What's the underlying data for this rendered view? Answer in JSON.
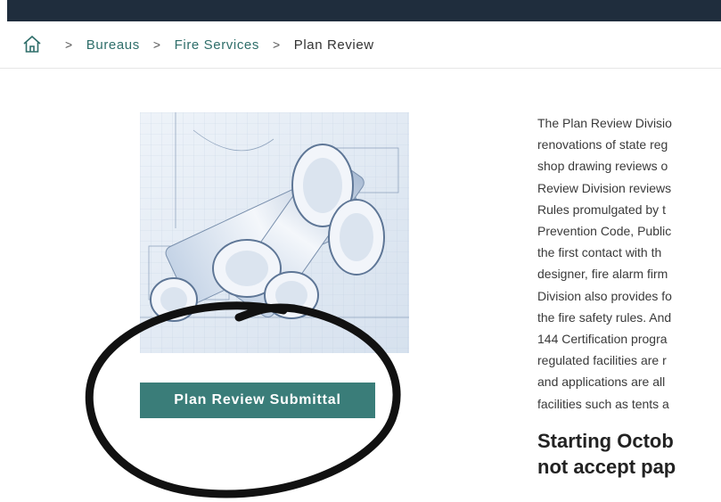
{
  "breadcrumb": {
    "items": [
      "Bureaus",
      "Fire Services"
    ],
    "current": "Plan Review",
    "separator": ">"
  },
  "hero": {
    "icon": "blueprint-rolls-image"
  },
  "cta": {
    "label": "Plan Review Submittal"
  },
  "annotation": {
    "type": "hand-drawn-circle",
    "color": "#111111"
  },
  "description": {
    "lines": [
      "The Plan Review Divisio",
      "renovations of state reg",
      "shop drawing reviews o",
      "Review Division reviews",
      "Rules promulgated by t",
      "Prevention Code, Public",
      "the first contact with th",
      "designer, fire alarm firm",
      "Division also provides fo",
      "the fire safety rules. And",
      "144 Certification progra",
      "regulated facilities are r",
      "and applications are all",
      "facilities such as tents a"
    ]
  },
  "heading": {
    "lines": [
      "Starting Octob",
      "not accept pap"
    ]
  },
  "colors": {
    "topbar": "#1f2d3d",
    "accent": "#3a7d79",
    "link": "#2f6e6a"
  }
}
